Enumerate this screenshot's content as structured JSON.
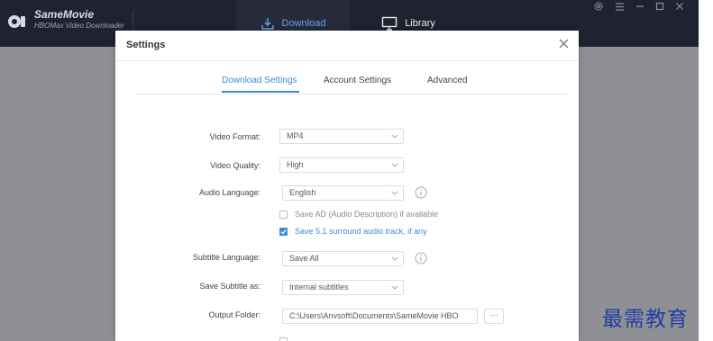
{
  "app": {
    "name": "SameMovie",
    "subtitle": "HBOMax Video Downloader",
    "nav": {
      "download": "Download",
      "library": "Library"
    },
    "colors": {
      "titlebar": "#1f2230",
      "accent": "#3f8ad8",
      "overlay": "#8f9094"
    }
  },
  "window_controls": {
    "icons": [
      "gear-icon",
      "menu-icon",
      "minimize-icon",
      "maximize-icon",
      "close-icon"
    ]
  },
  "settings": {
    "title": "Settings",
    "tabs": [
      {
        "label": "Download Settings",
        "active": true
      },
      {
        "label": "Account Settings",
        "active": false
      },
      {
        "label": "Advanced",
        "active": false
      }
    ],
    "fields": {
      "video_format": {
        "label": "Video Format:",
        "value": "MP4"
      },
      "video_quality": {
        "label": "Video Quality:",
        "value": "High"
      },
      "audio_language": {
        "label": "Audio Language:",
        "value": "English"
      },
      "save_ad": {
        "label": "Save AD (Audio Description) if avaliable",
        "checked": false
      },
      "save_51": {
        "label": "Save 5.1 surround audio track, if any",
        "checked": true
      },
      "subtitle_language": {
        "label": "Subtitle Language:",
        "value": "Save All"
      },
      "save_subtitle_as": {
        "label": "Save Subtitle as:",
        "value": "Internal subtitles"
      },
      "output_folder": {
        "label": "Output Folder:",
        "value": "C:\\Users\\Anvsoft\\Documents\\SameMovie HBO",
        "browse_label": "···"
      }
    }
  },
  "watermark": "最需教育"
}
